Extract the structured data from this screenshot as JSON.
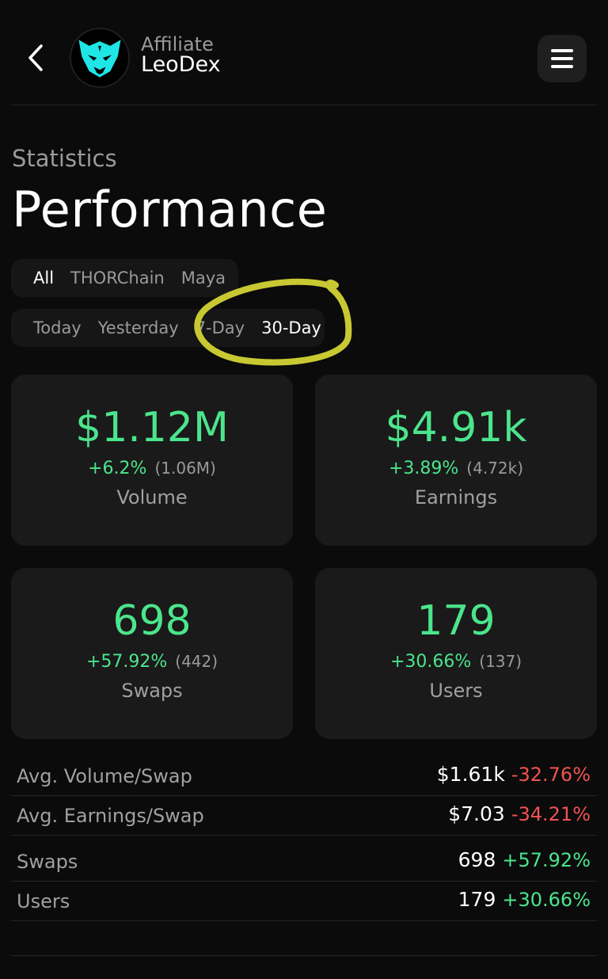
{
  "header": {
    "brand_subtitle": "Affiliate",
    "brand_name": "LeoDex",
    "logo_color": "#1fe6e6"
  },
  "page": {
    "eyebrow": "Statistics",
    "title": "Performance"
  },
  "chain_filter": {
    "options": [
      "All",
      "THORChain",
      "Maya"
    ],
    "selected": "All"
  },
  "period_filter": {
    "options": [
      "Today",
      "Yesterday",
      "7-Day",
      "30-Day"
    ],
    "selected": "30-Day"
  },
  "cards": [
    {
      "value": "$1.12M",
      "change": "+6.2%",
      "previous": "(1.06M)",
      "label": "Volume"
    },
    {
      "value": "$4.91k",
      "change": "+3.89%",
      "previous": "(4.72k)",
      "label": "Earnings"
    },
    {
      "value": "698",
      "change": "+57.92%",
      "previous": "(442)",
      "label": "Swaps"
    },
    {
      "value": "179",
      "change": "+30.66%",
      "previous": "(137)",
      "label": "Users"
    }
  ],
  "details": [
    {
      "label": "Avg. Volume/Swap",
      "value": "$1.61k",
      "change": "-32.76%",
      "trend": "negative"
    },
    {
      "label": "Avg. Earnings/Swap",
      "value": "$7.03",
      "change": "-34.21%",
      "trend": "negative"
    },
    {
      "label": "Swaps",
      "value": "698",
      "change": "+57.92%",
      "trend": "positive"
    },
    {
      "label": "Users",
      "value": "179",
      "change": "+30.66%",
      "trend": "positive"
    }
  ],
  "colors": {
    "accent_positive": "#4be58c",
    "accent_negative": "#f05252",
    "annotation_circle": "#c8c832"
  }
}
